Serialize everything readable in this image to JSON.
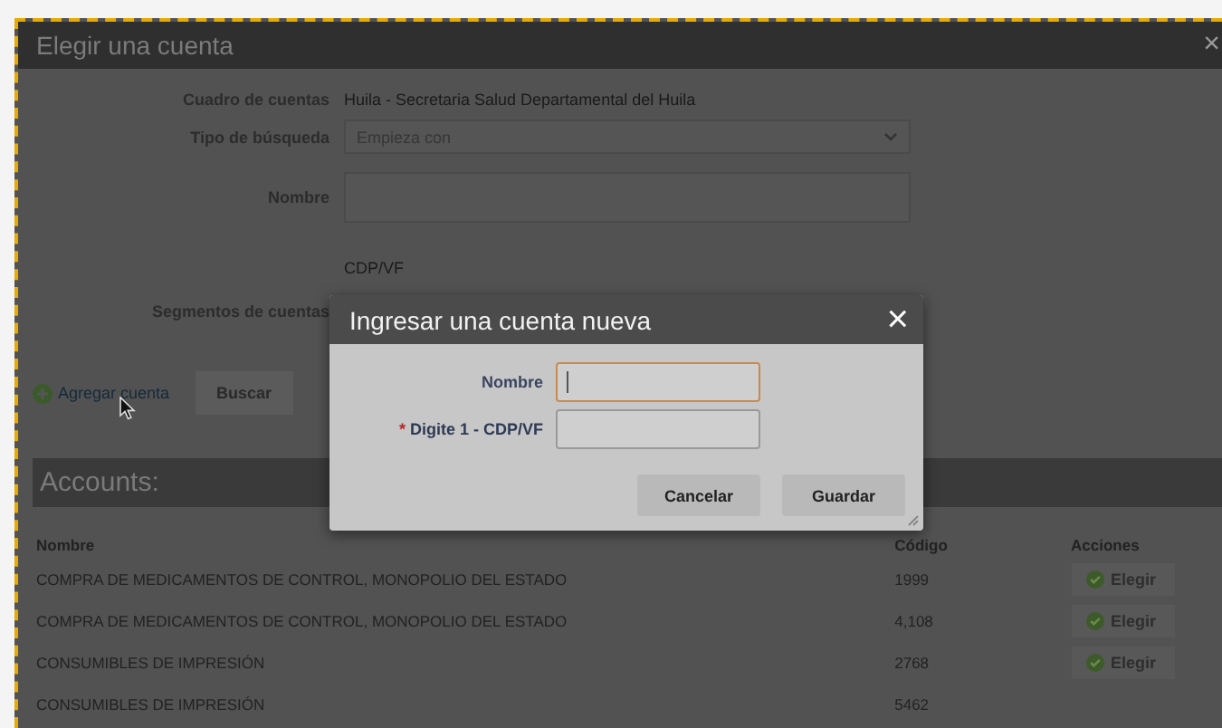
{
  "window": {
    "title": "Elegir una cuenta",
    "close": "×"
  },
  "form": {
    "fields": [
      {
        "kind": "text",
        "label": "Cuadro de cuentas",
        "value": "Huila - Secretaria Salud Departamental del Huila"
      },
      {
        "kind": "select",
        "label": "Tipo de búsqueda",
        "value": "Empieza con"
      },
      {
        "kind": "input",
        "label": "Nombre"
      },
      {
        "kind": "segments",
        "label": "Segmentos de cuentas",
        "heading": "CDP/VF"
      }
    ]
  },
  "actions": {
    "add_link": "Agregar cuenta",
    "search_button": "Buscar"
  },
  "accounts": {
    "title": "Accounts:",
    "columns": [
      "Nombre",
      "Código",
      "Acciones"
    ],
    "rows": [
      {
        "name": "COMPRA DE MEDICAMENTOS DE CONTROL, MONOPOLIO DEL ESTADO",
        "code": "1999",
        "action": "Elegir"
      },
      {
        "name": "COMPRA DE MEDICAMENTOS DE CONTROL, MONOPOLIO DEL ESTADO",
        "code": "4,108",
        "action": "Elegir"
      },
      {
        "name": "CONSUMIBLES DE IMPRESIÓN",
        "code": "2768",
        "action": "Elegir"
      },
      {
        "name": "CONSUMIBLES DE IMPRESIÓN",
        "code": "5462"
      }
    ]
  },
  "modal": {
    "title": "Ingresar una cuenta nueva",
    "close": "×",
    "fields": [
      {
        "label": "Nombre",
        "required": false,
        "focused": true
      },
      {
        "label": "Digite 1 - CDP/VF",
        "required": true,
        "mark": "*",
        "focused": false
      }
    ],
    "buttons": [
      "Cancelar",
      "Guardar"
    ]
  }
}
